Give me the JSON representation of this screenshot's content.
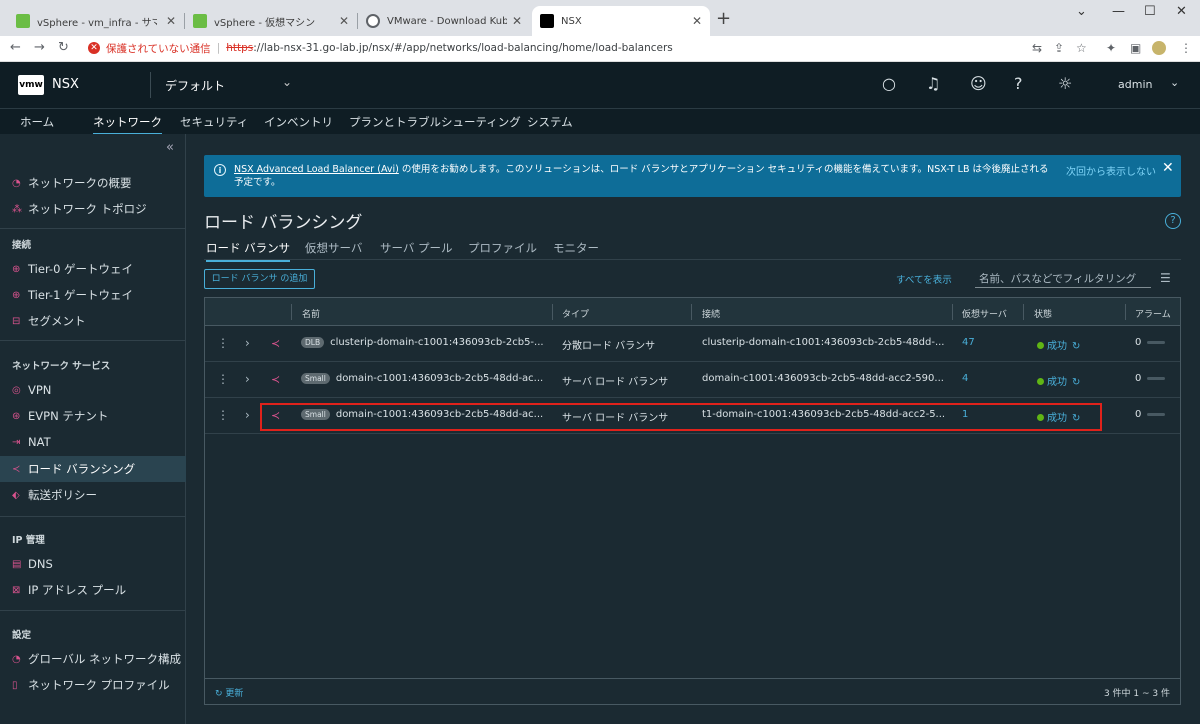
{
  "browser": {
    "tabs": [
      {
        "title": "vSphere - vm_infra - サマリ",
        "icon_color": "#6bbd45"
      },
      {
        "title": "vSphere - 仮想マシン",
        "icon_color": "#6bbd45"
      },
      {
        "title": "VMware - Download Kubernetes",
        "icon_color": "#5f6368"
      },
      {
        "title": "NSX",
        "icon_color": "#000000"
      }
    ],
    "security_warning": "保護されていない通信",
    "url_scheme": "https",
    "url_rest": "://lab-nsx-31.go-lab.jp/nsx/#/app/networks/load-balancing/home/load-balancers"
  },
  "header": {
    "logo": "vmw",
    "product": "NSX",
    "project": "デフォルト",
    "user": "admin"
  },
  "main_nav": [
    "ホーム",
    "ネットワーク",
    "セキュリティ",
    "インベントリ",
    "プランとトラブルシューティング",
    "システム"
  ],
  "main_nav_active": 1,
  "sidebar": {
    "top_items": [
      {
        "label": "ネットワークの概要",
        "icon": "network-overview-icon"
      },
      {
        "label": "ネットワーク トポロジ",
        "icon": "topology-icon"
      }
    ],
    "groups": [
      {
        "title": "接続",
        "items": [
          {
            "label": "Tier-0 ゲートウェイ",
            "icon": "tier0-icon"
          },
          {
            "label": "Tier-1 ゲートウェイ",
            "icon": "tier1-icon"
          },
          {
            "label": "セグメント",
            "icon": "segment-icon"
          }
        ]
      },
      {
        "title": "ネットワーク サービス",
        "items": [
          {
            "label": "VPN",
            "icon": "vpn-icon"
          },
          {
            "label": "EVPN テナント",
            "icon": "evpn-icon"
          },
          {
            "label": "NAT",
            "icon": "nat-icon"
          },
          {
            "label": "ロード バランシング",
            "icon": "load-balancing-icon",
            "active": true
          },
          {
            "label": "転送ポリシー",
            "icon": "forwarding-policy-icon"
          }
        ]
      },
      {
        "title": "IP 管理",
        "items": [
          {
            "label": "DNS",
            "icon": "dns-icon"
          },
          {
            "label": "IP アドレス プール",
            "icon": "ip-pool-icon"
          }
        ]
      },
      {
        "title": "設定",
        "items": [
          {
            "label": "グローバル ネットワーク構成",
            "icon": "global-network-icon"
          },
          {
            "label": "ネットワーク プロファイル",
            "icon": "network-profile-icon"
          }
        ]
      }
    ]
  },
  "banner": {
    "link": "NSX Advanced Load Balancer (Avi)",
    "text": " の使用をお勧めします。このソリューションは、ロード バランサとアプリケーション セキュリティの機能を備えています。NSX-T LB は今後廃止される予定です。",
    "dismiss": "次回から表示しない"
  },
  "page": {
    "title": "ロード バランシング",
    "tabs": [
      "ロード バランサ",
      "仮想サーバ",
      "サーバ プール",
      "プロファイル",
      "モニター"
    ],
    "active_tab": 0,
    "add_button": "ロード バランサ の追加",
    "show_all": "すべてを表示",
    "filter_placeholder": "名前、パスなどでフィルタリング"
  },
  "table": {
    "columns": [
      "名前",
      "タイプ",
      "接続",
      "仮想サーバ",
      "状態",
      "アラーム"
    ],
    "rows": [
      {
        "badge": "DLB",
        "name": "clusterip-domain-c1001:436093cb-2cb5-...",
        "type": "分散ロード バランサ",
        "attachment": "clusterip-domain-c1001:436093cb-2cb5-48dd-...",
        "vs": "47",
        "status": "成功",
        "alarms": "0"
      },
      {
        "badge": "Small",
        "name": "domain-c1001:436093cb-2cb5-48dd-ac...",
        "type": "サーバ ロード バランサ",
        "attachment": "domain-c1001:436093cb-2cb5-48dd-acc2-590...",
        "vs": "4",
        "status": "成功",
        "alarms": "0"
      },
      {
        "badge": "Small",
        "name": "domain-c1001:436093cb-2cb5-48dd-ac...",
        "type": "サーバ ロード バランサ",
        "attachment": "t1-domain-c1001:436093cb-2cb5-48dd-acc2-5...",
        "vs": "1",
        "status": "成功",
        "alarms": "0"
      }
    ],
    "refresh": "更新",
    "count": "3 件中 1 ~ 3 件"
  },
  "colors": {
    "accent": "#49afd9",
    "success": "#60b515",
    "highlight": "#e0221b",
    "lb_icon": "#d9538e"
  }
}
